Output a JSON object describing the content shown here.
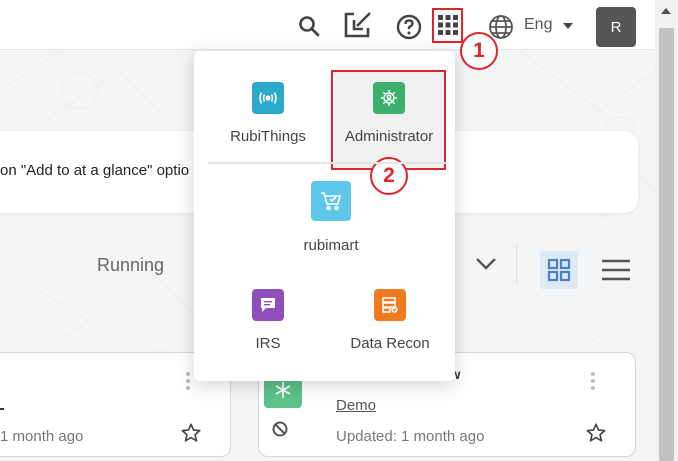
{
  "header": {
    "language": "Eng",
    "avatar_initial": "R",
    "icons": [
      "search-icon",
      "import-icon",
      "help-icon",
      "apps-grid-icon",
      "globe-icon",
      "caret-down-icon"
    ]
  },
  "annotations": {
    "step1": "1",
    "step2": "2"
  },
  "notice": {
    "text": "on \"Add to at a glance\" optio"
  },
  "filters": {
    "status_label": "Running"
  },
  "apps_menu": {
    "items": [
      {
        "label": "RubiThings",
        "icon": "broadcast-icon",
        "color": "#2aa9c9"
      },
      {
        "label": "Administrator",
        "icon": "admin-gear-icon",
        "color": "#3cae6e"
      },
      {
        "label": "rubimart",
        "icon": "cart-icon",
        "color": "#5ec6e8"
      },
      {
        "label": "IRS",
        "icon": "chat-icon",
        "color": "#8e4fba"
      },
      {
        "label": "Data Recon",
        "icon": "data-check-icon",
        "color": "#f07b1e"
      }
    ]
  },
  "cards": {
    "left": {
      "updated": "1 month ago"
    },
    "right": {
      "title_partial": "ow",
      "link": "Demo",
      "updated": "Updated: 1 month ago"
    }
  },
  "colors": {
    "highlight": "#e0242b",
    "grid_view_bg": "#dfe8f5"
  }
}
